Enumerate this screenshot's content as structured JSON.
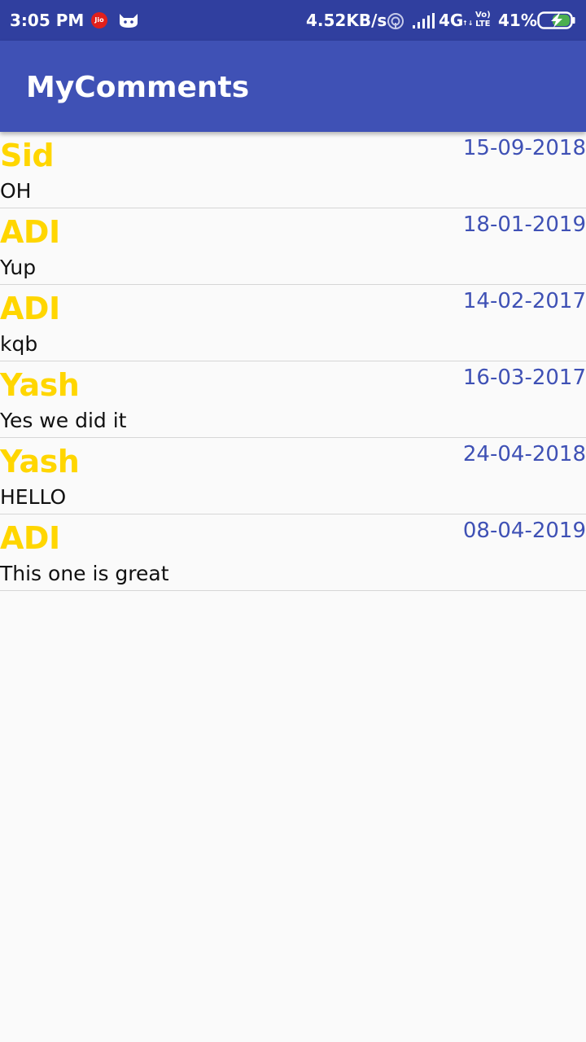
{
  "status_bar": {
    "time": "3:05 PM",
    "carrier_badge": "Jio",
    "net_speed": "4.52KB/s",
    "network_type": "4G",
    "network_sup": "↑↓",
    "volte_line1": "Vo)",
    "volte_line2": "LTE",
    "battery_percent": "41%",
    "icons": [
      "jio-icon",
      "cat-notification-icon",
      "hotspot-icon",
      "signal-icon",
      "battery-charging-icon"
    ]
  },
  "app_bar": {
    "title": "MyComments",
    "color": "#3f51b5"
  },
  "colors": {
    "status_bar": "#303f9f",
    "name": "#ffd600",
    "date": "#3f51b5",
    "background": "#fafafa"
  },
  "comments": [
    {
      "name": "Sid",
      "date": "15-09-2018",
      "text": "OH"
    },
    {
      "name": "ADI",
      "date": "18-01-2019",
      "text": "Yup"
    },
    {
      "name": "ADI",
      "date": "14-02-2017",
      "text": "kqb"
    },
    {
      "name": "Yash",
      "date": "16-03-2017",
      "text": "Yes we did it"
    },
    {
      "name": "Yash",
      "date": "24-04-2018",
      "text": "HELLO"
    },
    {
      "name": "ADI",
      "date": "08-04-2019",
      "text": "This one is great"
    }
  ]
}
